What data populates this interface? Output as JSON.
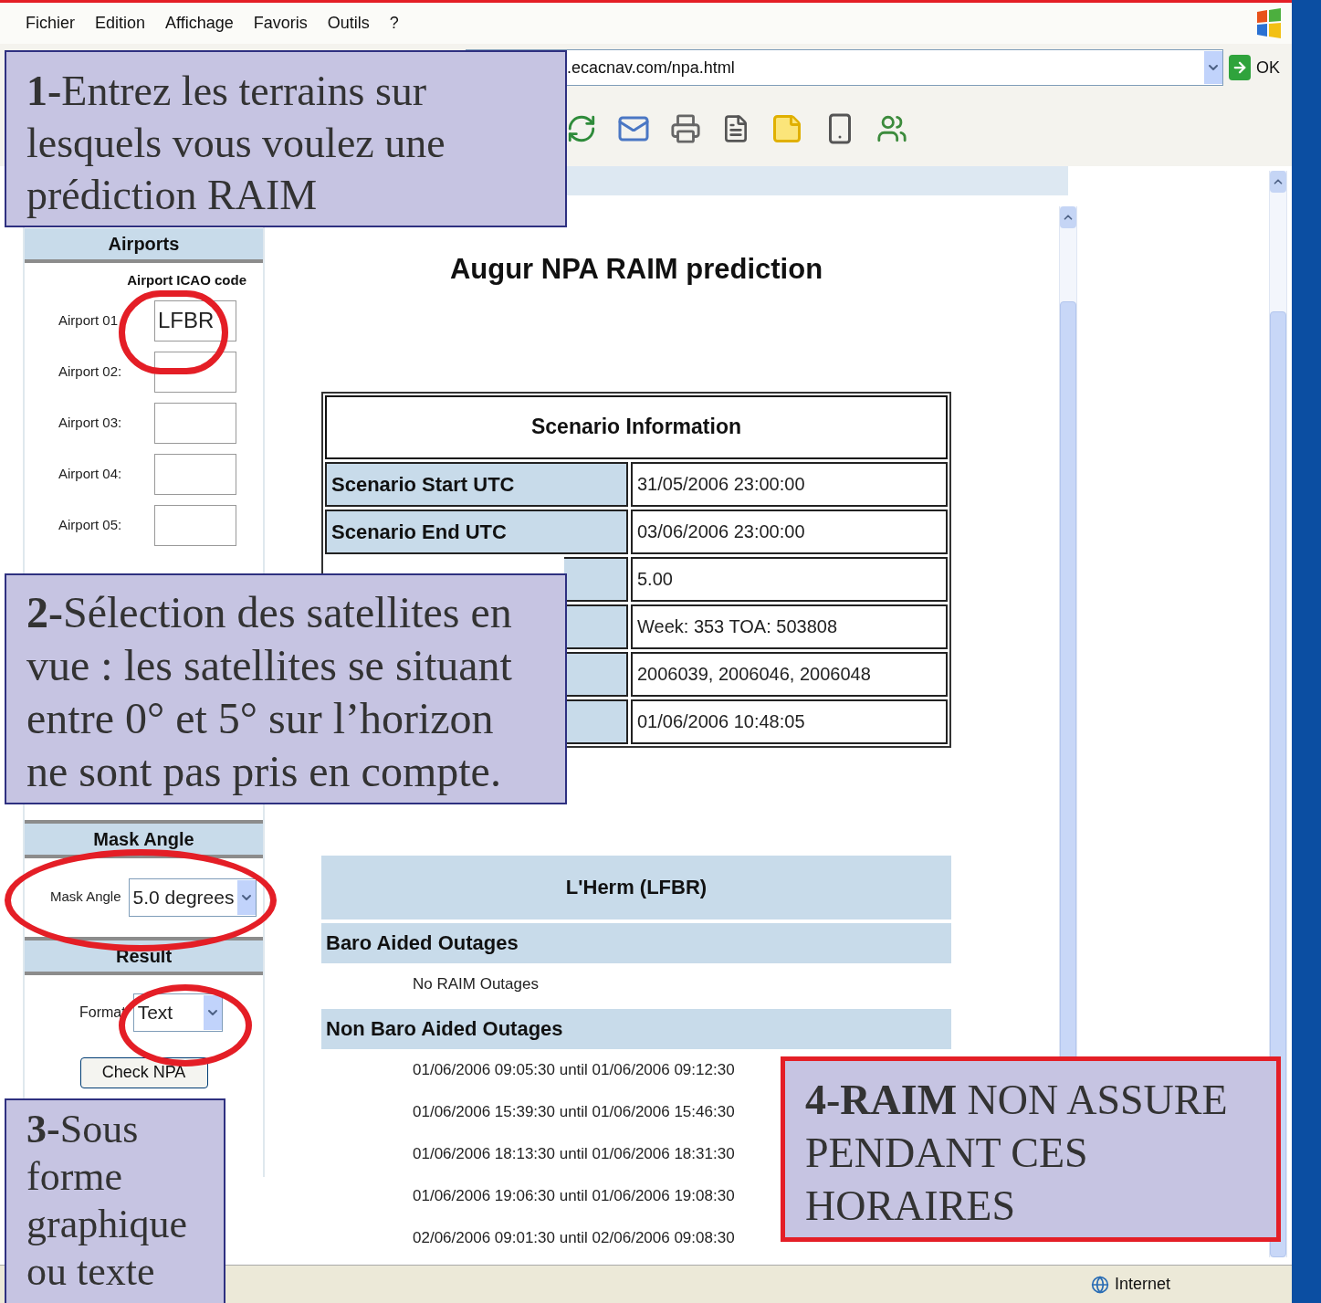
{
  "menu": [
    "Fichier",
    "Edition",
    "Affichage",
    "Favoris",
    "Outils",
    "?"
  ],
  "address": {
    "value": ".ecacnav.com/npa.html",
    "go_label": "OK"
  },
  "sidebar": {
    "airports_title": "Airports",
    "code_heading": "Airport ICAO code",
    "airports": [
      {
        "label": "Airport 01",
        "value": "LFBR"
      },
      {
        "label": "Airport 02:"
      },
      {
        "label": "Airport 03:"
      },
      {
        "label": "Airport 04:"
      },
      {
        "label": "Airport 05:"
      }
    ],
    "mask_title": "Mask Angle",
    "mask_label": "Mask Angle",
    "mask_value": "5.0 degrees",
    "result_title": "Result",
    "format_label": "Format",
    "format_value": "Text",
    "check_button": "Check NPA"
  },
  "page_title": "Augur NPA RAIM prediction",
  "scenario": {
    "title": "Scenario Information",
    "rows": [
      {
        "label": "Scenario Start UTC",
        "value": "31/05/2006 23:00:00"
      },
      {
        "label": "Scenario End UTC",
        "value": "03/06/2006 23:00:00"
      },
      {
        "value": "5.00"
      },
      {
        "value": "Week: 353 TOA: 503808"
      },
      {
        "value": "2006039, 2006046, 2006048"
      },
      {
        "value": "01/06/2006 10:48:05"
      }
    ]
  },
  "airport_result": {
    "title": "L'Herm (LFBR)",
    "sections": [
      {
        "title": "Baro Aided Outages",
        "items": [
          "No RAIM Outages"
        ]
      },
      {
        "title": "Non Baro Aided Outages",
        "items": [
          "01/06/2006 09:05:30 until 01/06/2006 09:12:30",
          "01/06/2006 15:39:30 until 01/06/2006 15:46:30",
          "01/06/2006 18:13:30 until 01/06/2006 18:31:30",
          "01/06/2006 19:06:30 until 01/06/2006 19:08:30",
          "02/06/2006 09:01:30 until 02/06/2006 09:08:30"
        ]
      }
    ]
  },
  "status_bar": {
    "zone": "Internet"
  },
  "callouts": [
    {
      "text": "**1-**Entrez les terrains sur lesquels vous voulez une prédiction RAIM",
      "highlighted": false
    },
    {
      "text": "**2-**Sélection des satellites en vue : les satellites se situant entre 0° et 5° sur l’horizon ne sont pas pris en compte.",
      "highlighted": false
    },
    {
      "text": "**3-**Sous forme graphique ou texte",
      "highlighted": false
    },
    {
      "text": "**4-RAIM** NON ASSURE PENDANT CES HORAIRES",
      "highlighted": true
    }
  ]
}
